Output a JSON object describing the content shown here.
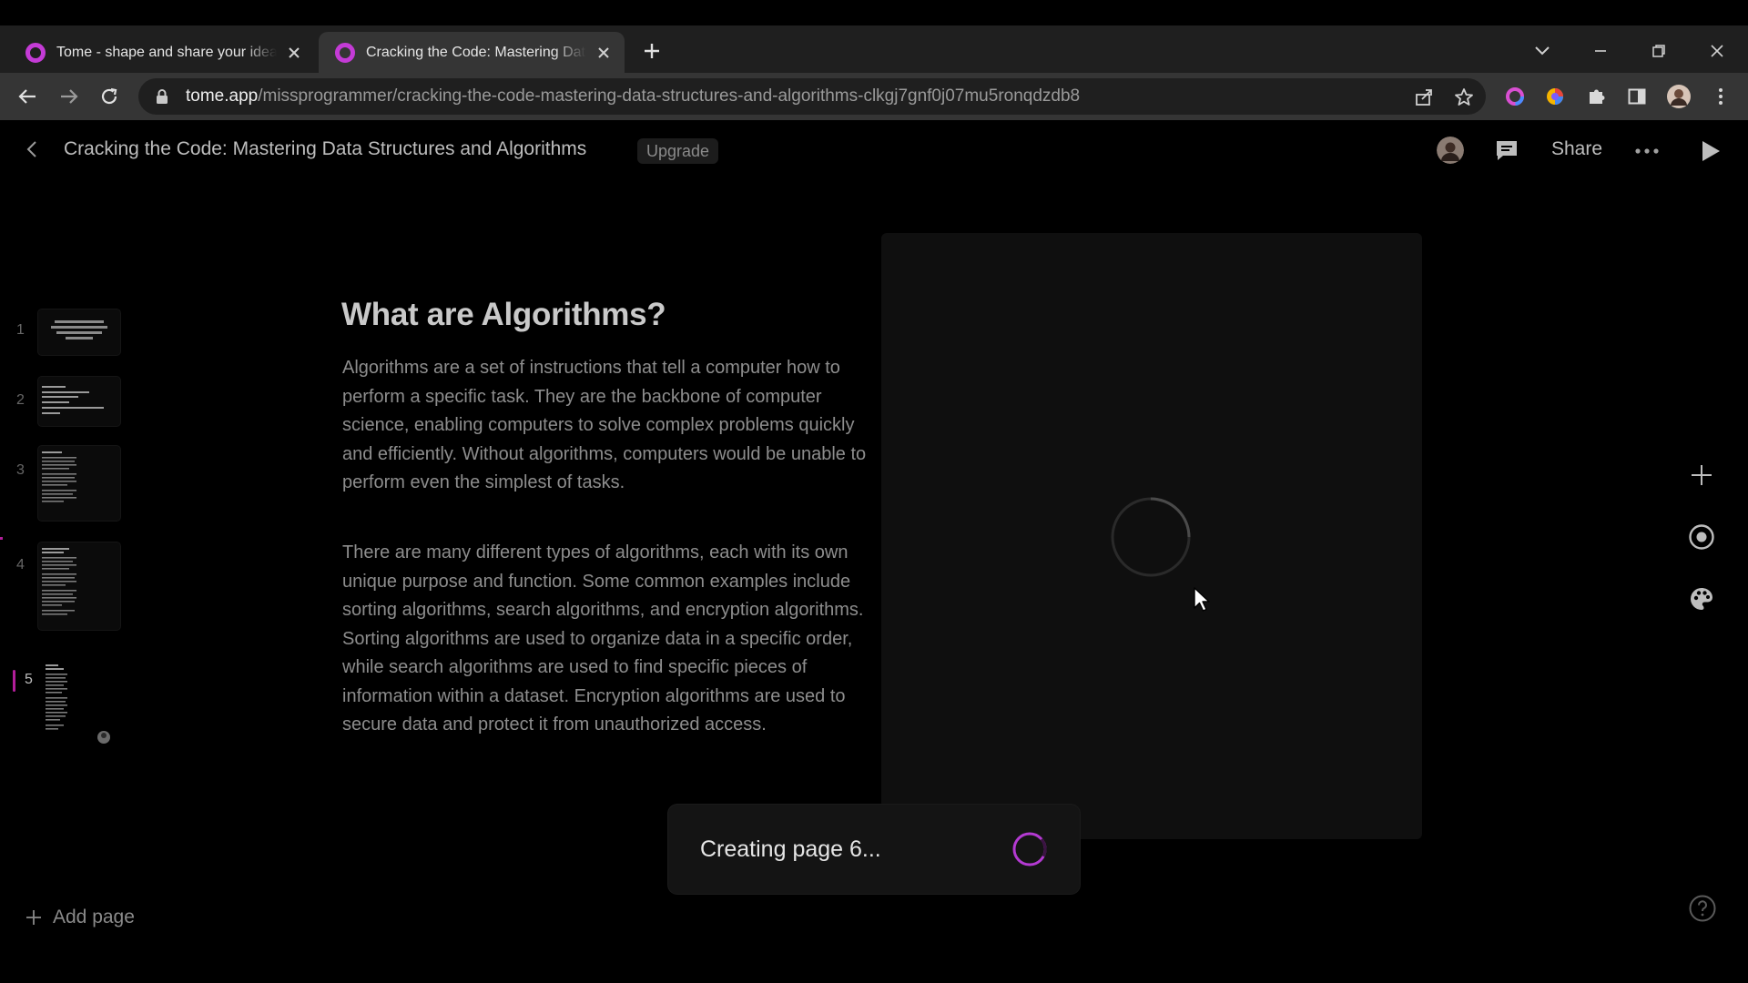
{
  "browser": {
    "tabs": [
      {
        "title": "Tome - shape and share your ideas",
        "active": false
      },
      {
        "title": "Cracking the Code: Mastering Data Structures and Algorithms",
        "active": true
      }
    ],
    "url_host": "tome.app",
    "url_path": "/missprogrammer/cracking-the-code-mastering-data-structures-and-algorithms-clkgj7gnf0j07mu5ronqdzdb8",
    "icons": {
      "tab_favicon": "tome-logo-icon",
      "new_tab": "plus-icon",
      "tab_search": "chevron-down-icon",
      "minimize": "minimize-icon",
      "restore": "restore-icon",
      "close": "close-icon",
      "back": "arrow-left-icon",
      "forward": "arrow-right-icon",
      "reload": "reload-icon",
      "lock": "lock-icon",
      "share_page": "share-icon",
      "bookmark": "star-icon",
      "extensions": [
        "ring-extension-icon",
        "colorful-extension-icon",
        "puzzle-icon",
        "side-panel-icon",
        "profile-avatar",
        "kebab-menu-icon"
      ]
    },
    "accent_color": "#c43bd6"
  },
  "app_header": {
    "title": "Cracking the Code: Mastering Data Structures and Algorithms",
    "upgrade_label": "Upgrade",
    "share_label": "Share"
  },
  "sidebar": {
    "pages": [
      {
        "number": "1"
      },
      {
        "number": "2"
      },
      {
        "number": "3"
      },
      {
        "number": "4"
      },
      {
        "number": "5",
        "active": true
      }
    ],
    "add_page_label": "Add page",
    "active_color": "#b21e9a"
  },
  "slide": {
    "heading": "What are Algorithms?",
    "paragraphs": [
      "Algorithms are a set of instructions that tell a computer how to perform a specific task. They are the backbone of computer science, enabling computers to solve complex problems quickly and efficiently. Without algorithms, computers would be unable to perform even the simplest of tasks.",
      "There are many different types of algorithms, each with its own unique purpose and function. Some common examples include sorting algorithms, search algorithms, and encryption algorithms. Sorting algorithms are used to organize data in a specific order, while search algorithms are used to find specific pieces of information within a dataset. Encryption algorithms are used to secure data and protect it from unauthorized access."
    ]
  },
  "toast": {
    "text": "Creating page 6...",
    "spinner_color": "#b43ad2"
  },
  "rail": {
    "icons": [
      "plus-icon",
      "record-icon",
      "palette-icon"
    ]
  }
}
